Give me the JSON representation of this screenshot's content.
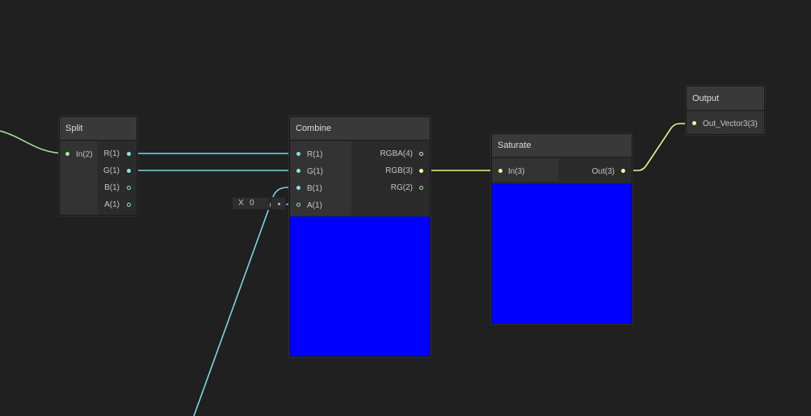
{
  "colors": {
    "canvas_bg": "#202020",
    "wire_float": "#7ad6e6",
    "wire_vector3": "#f2f28c",
    "wire_vector_in": "#9be38e",
    "port_float": "#84e4e7",
    "port_vector3": "#f6ff9a",
    "port_vector4": "#fbcbf4",
    "port_vector2": "#9aef92",
    "preview_color": "#0000ff"
  },
  "nodes": {
    "split": {
      "title": "Split",
      "inputs": [
        {
          "label": "In(2)",
          "icon": "vector2-port-icon"
        }
      ],
      "outputs": [
        {
          "label": "R(1)",
          "icon": "float-port-icon",
          "connected": true
        },
        {
          "label": "G(1)",
          "icon": "float-port-icon",
          "connected": true
        },
        {
          "label": "B(1)",
          "icon": "float-port-icon",
          "connected": false
        },
        {
          "label": "A(1)",
          "icon": "float-port-icon",
          "connected": false
        }
      ]
    },
    "combine": {
      "title": "Combine",
      "inputs": [
        {
          "label": "R(1)",
          "icon": "float-port-icon",
          "connected": true
        },
        {
          "label": "G(1)",
          "icon": "float-port-icon",
          "connected": true
        },
        {
          "label": "B(1)",
          "icon": "float-port-icon",
          "connected": true
        },
        {
          "label": "A(1)",
          "icon": "float-port-icon",
          "connected": false
        }
      ],
      "outputs": [
        {
          "label": "RGBA(4)",
          "icon": "vector4-port-icon",
          "connected": false
        },
        {
          "label": "RGB(3)",
          "icon": "vector3-port-icon",
          "connected": true
        },
        {
          "label": "RG(2)",
          "icon": "vector2-port-icon",
          "connected": false
        }
      ],
      "inline_input": {
        "axis": "X",
        "value": "0"
      }
    },
    "saturate": {
      "title": "Saturate",
      "inputs": [
        {
          "label": "In(3)",
          "icon": "vector3-port-icon",
          "connected": true
        }
      ],
      "outputs": [
        {
          "label": "Out(3)",
          "icon": "vector3-port-icon",
          "connected": true
        }
      ]
    },
    "output": {
      "title": "Output",
      "inputs": [
        {
          "label": "Out_Vector3(3)",
          "icon": "vector3-port-icon",
          "connected": true
        }
      ]
    }
  }
}
